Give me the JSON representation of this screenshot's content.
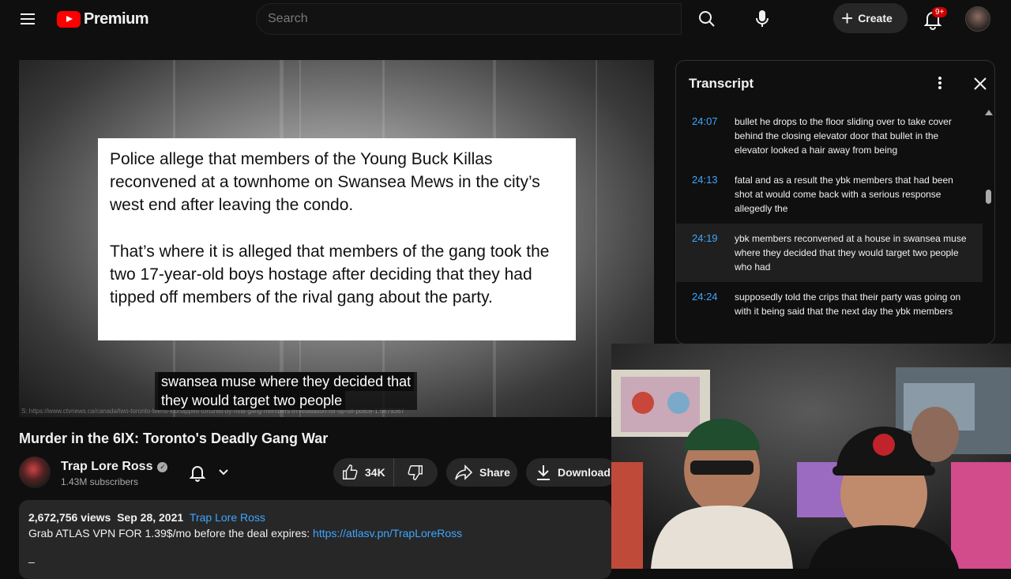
{
  "header": {
    "logo_text": "Premium",
    "search_placeholder": "Search",
    "create_label": "Create",
    "notification_badge": "9+"
  },
  "player": {
    "news_paragraph_1": "Police allege that members of the Young Buck Killas reconvened at a townhome on Swansea Mews in the city’s west end after leaving the condo.",
    "news_paragraph_2": "That’s where it is alleged that members of the gang took the two 17-year-old boys hostage after deciding that they had tipped off members of the rival gang about the party.",
    "caption_line_1": "swansea muse where they decided that",
    "caption_line_2": "they would target two people"
  },
  "video": {
    "title": "Murder in the 6IX: Toronto's Deadly Gang War",
    "channel_name": "Trap Lore Ross",
    "subscribers": "1.43M subscribers",
    "likes": "34K",
    "share_label": "Share",
    "download_label": "Download"
  },
  "description": {
    "views": "2,672,756 views",
    "date": "Sep 28, 2021",
    "channel_link": "Trap Lore Ross",
    "promo_text": "Grab ATLAS VPN FOR 1.39$/mo before the deal expires: ",
    "promo_link": "https://atlasv.pn/TrapLoreRoss",
    "trailing": "_"
  },
  "transcript": {
    "title": "Transcript",
    "items": [
      {
        "time": "24:07",
        "text": "bullet he drops to the floor sliding over to take cover behind the closing elevator door that bullet in the elevator looked a hair away from being"
      },
      {
        "time": "24:13",
        "text": "fatal and as a result the ybk members that had been shot at would come back with a serious response allegedly the"
      },
      {
        "time": "24:19",
        "text": "ybk members reconvened at a house in swansea muse where they decided that they would target two people who had"
      },
      {
        "time": "24:24",
        "text": "supposedly told the crips that their party was going on with it being said that the next day the ybk members"
      }
    ]
  },
  "colors": {
    "background": "#0f0f0f",
    "accent_red": "#ff0000",
    "link_blue": "#3ea6ff",
    "pill_bg": "#272727"
  },
  "icons": [
    "menu-icon",
    "youtube-logo-icon",
    "search-icon",
    "mic-icon",
    "plus-icon",
    "bell-icon",
    "verified-icon",
    "chevron-down-icon",
    "thumbs-up-icon",
    "thumbs-down-icon",
    "share-icon",
    "download-icon",
    "more-vert-icon",
    "close-icon"
  ]
}
